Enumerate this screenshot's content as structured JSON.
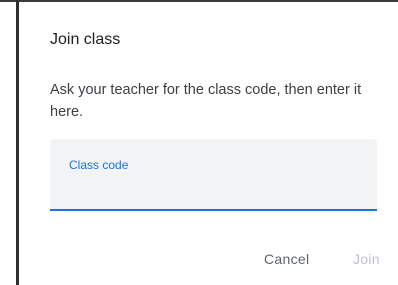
{
  "dialog": {
    "title": "Join class",
    "description": "Ask your teacher for the class code, then enter it here.",
    "field": {
      "label": "Class code",
      "value": ""
    },
    "buttons": {
      "cancel_label": "Cancel",
      "join_label": "Join"
    }
  },
  "colors": {
    "accent": "#1a73e8",
    "field_background": "#f1f3f4",
    "text_primary": "#202124",
    "text_secondary": "#5f6368",
    "disabled": "#bdc1c6"
  }
}
